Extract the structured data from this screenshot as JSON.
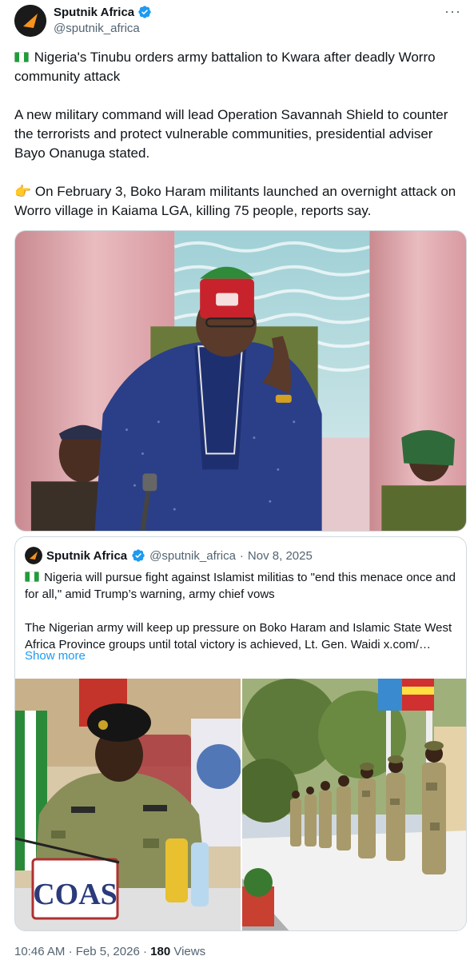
{
  "account": {
    "name": "Sputnik Africa",
    "handle": "@sputnik_africa",
    "avatar_icon": "sputnik-logo-icon",
    "verified_color": "#1d9bf0",
    "more_label": "···"
  },
  "tweet": {
    "paragraph1": "Nigeria's Tinubu orders army battalion to Kwara after deadly Worro community attack",
    "paragraph2": "A new military command will lead Operation Savannah Shield to counter the terrorists and protect vulnerable communities, presidential adviser Bayo Onanuga stated.",
    "paragraph3_emoji": "👉",
    "paragraph3": "On February 3, Boko Haram militants launched an overnight attack on Worro village in Kaiama LGA, killing 75 people, reports say.",
    "flag_icon": "nigeria-flag-icon"
  },
  "quote": {
    "name": "Sputnik Africa",
    "handle": "@sputnik_africa",
    "separator": "·",
    "date": "Nov 8, 2025",
    "paragraph1": "Nigeria will pursue fight against Islamist militias to \"end this menace once and for all,\" amid Trump’s warning, army chief vows",
    "paragraph2": "The Nigerian army will keep up pressure on Boko Haram and Islamic State West Africa Province groups until total victory is achieved, Lt. Gen. Waidi  x.com/…",
    "show_more": "Show more",
    "placard_text": "COAS"
  },
  "footer": {
    "time": "10:46 AM",
    "separator": "·",
    "date": "Feb 5, 2026",
    "views_count": "180",
    "views_label": "Views"
  },
  "colors": {
    "text": "#0f1419",
    "secondary": "#536471",
    "link": "#1d9bf0",
    "border": "#cfd9de",
    "brand_orange": "#f7931e"
  }
}
